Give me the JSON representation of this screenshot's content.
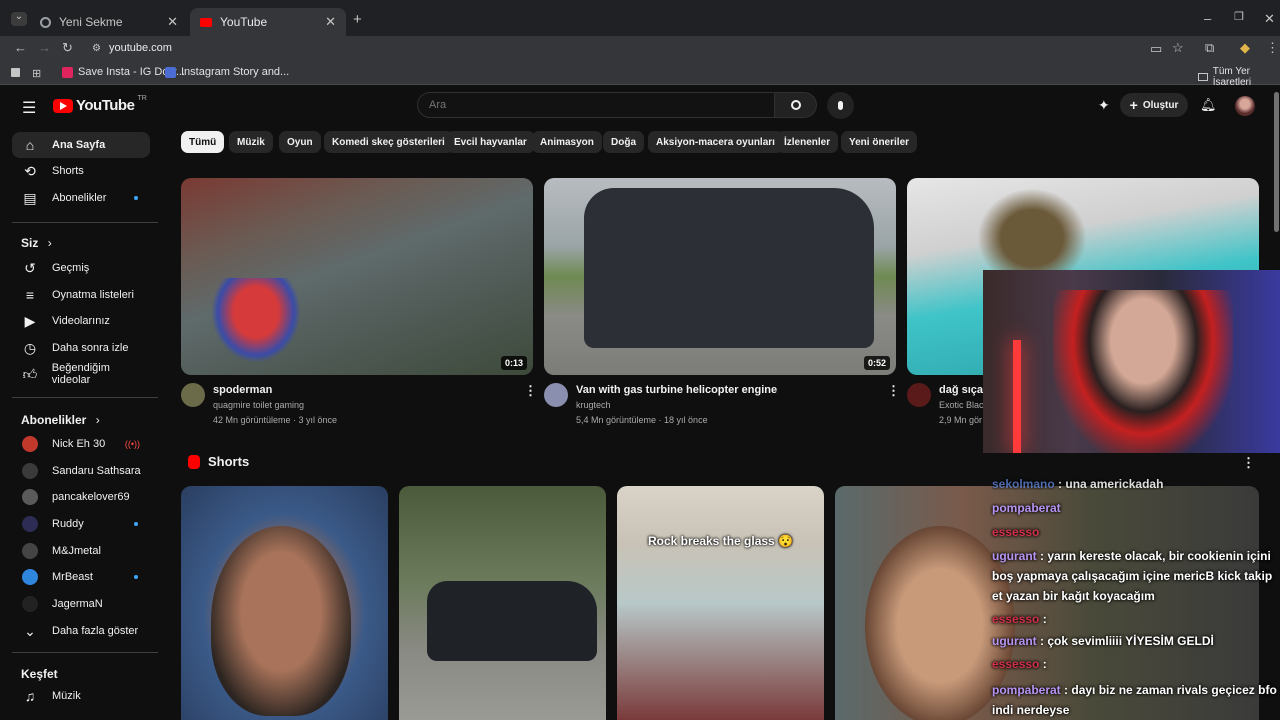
{
  "browser": {
    "tabs": [
      {
        "label": "Yeni Sekme",
        "active": false
      },
      {
        "label": "YouTube",
        "active": true
      }
    ],
    "url": "youtube.com",
    "bookmarks": [
      "Save Insta - IG Dow...",
      "Instagram Story and..."
    ],
    "all_bookmarks": "Tüm Yer İşaretleri"
  },
  "youtube": {
    "logo": "YouTube",
    "region": "TR",
    "search_placeholder": "Ara",
    "create_label": "Oluştur",
    "sidebar": {
      "main": [
        {
          "label": "Ana Sayfa",
          "icon": "home-icon"
        },
        {
          "label": "Shorts",
          "icon": "shorts-icon"
        },
        {
          "label": "Abonelikler",
          "icon": "subscriptions-icon"
        }
      ],
      "you_heading": "Siz",
      "you": [
        {
          "label": "Geçmiş",
          "icon": "history-icon"
        },
        {
          "label": "Oynatma listeleri",
          "icon": "playlist-icon"
        },
        {
          "label": "Videolarınız",
          "icon": "your-videos-icon"
        },
        {
          "label": "Daha sonra izle",
          "icon": "watch-later-icon"
        },
        {
          "label": "Beğendiğim videolar",
          "icon": "like-icon"
        }
      ],
      "subs_heading": "Abonelikler",
      "subscriptions": [
        {
          "label": "Nick Eh 30",
          "color": "#c0392b"
        },
        {
          "label": "Sandaru Sathsara",
          "color": "#3a3a3a"
        },
        {
          "label": "pancakelover69",
          "color": "#5a5a5a"
        },
        {
          "label": "Ruddy",
          "color": "#2c2c54"
        },
        {
          "label": "M&Jmetal",
          "color": "#444"
        },
        {
          "label": "MrBeast",
          "color": "#2e86de"
        },
        {
          "label": "JagermaN",
          "color": "#222"
        }
      ],
      "show_more": "Daha fazla göster",
      "explore_heading": "Keşfet",
      "explore": [
        {
          "label": "Müzik",
          "icon": "music-icon"
        }
      ]
    },
    "chips": [
      "Tümü",
      "Müzik",
      "Oyun",
      "Komedi skeç gösterileri",
      "Evcil hayvanlar",
      "Animasyon",
      "Doğa",
      "Aksiyon-macera oyunları",
      "İzlenenler",
      "Yeni öneriler"
    ],
    "videos": [
      {
        "title": "spoderman",
        "channel": "quagmire toilet gaming",
        "stats": "42 Mn görüntüleme · 3 yıl önce",
        "duration": "0:13"
      },
      {
        "title": "Van with gas turbine helicopter engine",
        "channel": "krugtech",
        "stats": "5,4 Mn görüntüleme · 18 yıl önce",
        "duration": "0:52"
      },
      {
        "title": "dağ sıçan",
        "channel": "Exotic Blac",
        "stats": "2,9 Mn gör",
        "duration": ""
      }
    ],
    "shorts_heading": "Shorts",
    "shorts_caption": "Rock breaks the glass 😯"
  },
  "stream_chat": [
    {
      "user": "sekolmano",
      "text": ": una americkadah"
    },
    {
      "user": "pompaberat",
      "text": ""
    },
    {
      "user": "essesso",
      "text": ""
    },
    {
      "user": "ugurant",
      "text": ": yarın kereste olacak, bir cookienin içini boş yapmaya çalışacağım içine mericB kick takip et yazan bir kağıt koyacağım"
    },
    {
      "user": "essesso",
      "text": ":"
    },
    {
      "user": "ugurant",
      "text": ": çok sevimliiii YİYESİM GELDİ"
    },
    {
      "user": "essesso",
      "text": ":"
    },
    {
      "user": "pompaberat",
      "text": ": dayı biz ne zaman rivals geçicez bfo indi nerdeyse"
    }
  ]
}
